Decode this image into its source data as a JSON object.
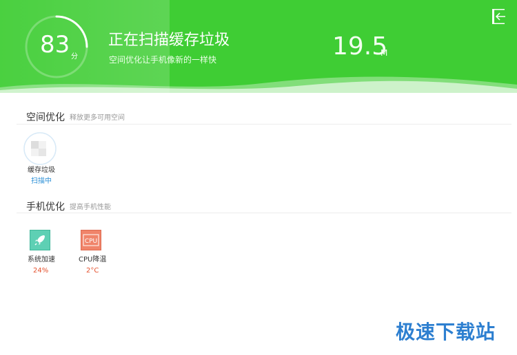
{
  "header": {
    "score": "83",
    "score_unit": "分",
    "title": "正在扫描缓存垃圾",
    "subtitle": "空间优化让手机像新的一样快",
    "size_value": "19.5",
    "size_unit": "M",
    "accent_color": "#3fcd34",
    "exit_icon": "exit-icon"
  },
  "space_section": {
    "title": "空间优化",
    "hint": "释放更多可用空间",
    "items": [
      {
        "label": "缓存垃圾",
        "status": "扫描中",
        "status_color": "#2b8fd6",
        "icon": "cache-junk-icon"
      }
    ]
  },
  "phone_section": {
    "title": "手机优化",
    "hint": "提高手机性能",
    "items": [
      {
        "label": "系统加速",
        "status": "24%",
        "status_color": "#e4502c",
        "icon": "rocket-icon"
      },
      {
        "label": "CPU降温",
        "status": "2°C",
        "status_color": "#e4502c",
        "icon": "cpu-icon",
        "icon_text": "CPU"
      }
    ]
  },
  "watermark": "极速下载站"
}
